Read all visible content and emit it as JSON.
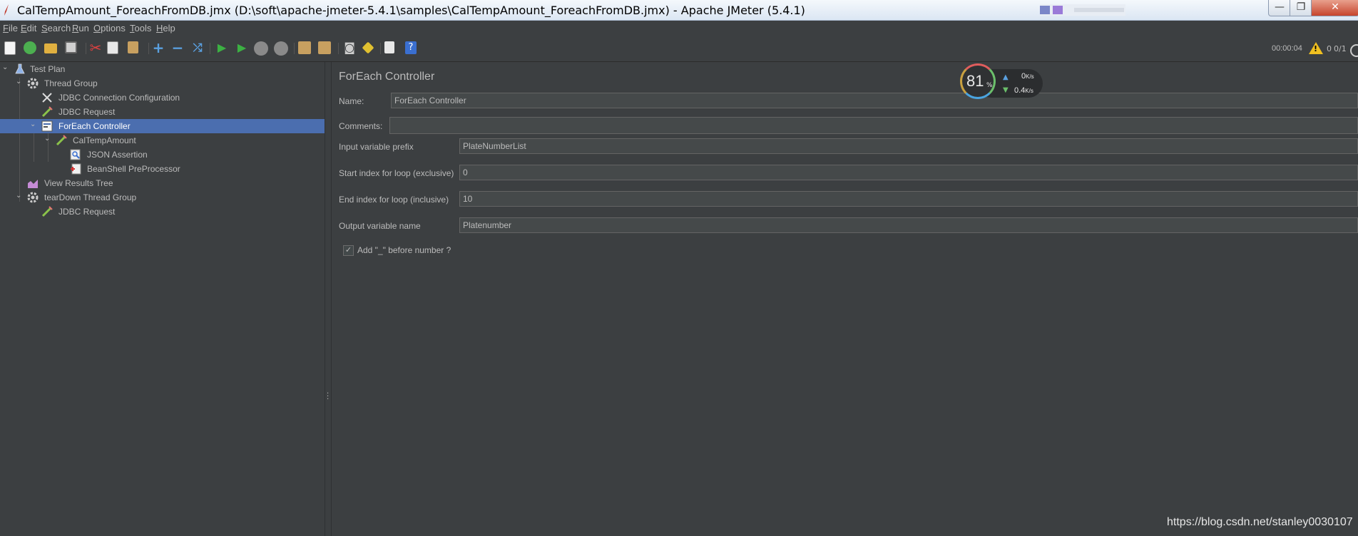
{
  "window": {
    "title": "CalTempAmount_ForeachFromDB.jmx (D:\\soft\\apache-jmeter-5.4.1\\samples\\CalTempAmount_ForeachFromDB.jmx) - Apache JMeter (5.4.1)",
    "min_glyph": "—",
    "max_glyph": "❐",
    "close_glyph": "✕"
  },
  "menu": [
    "File",
    "Edit",
    "Search",
    "Run",
    "Options",
    "Tools",
    "Help"
  ],
  "toolbar": {
    "icons": [
      "new-icon",
      "templates-icon",
      "open-icon",
      "save-icon",
      "cut-icon",
      "copy-icon",
      "paste-icon",
      "expand-icon",
      "collapse-icon",
      "toggle-icon",
      "start-icon",
      "start-no-pause-icon",
      "stop-icon",
      "shutdown-icon",
      "clear-icon",
      "clear-all-icon",
      "search-icon",
      "reset-search-icon",
      "function-helper-icon",
      "help-icon"
    ],
    "elapsed": "00:00:04",
    "error_count": "0",
    "threads": "0/1"
  },
  "tree": {
    "nodes": [
      {
        "label": "Test Plan",
        "icon": "flask-icon"
      },
      {
        "label": "Thread Group",
        "icon": "gear-icon"
      },
      {
        "label": "JDBC Connection Configuration",
        "icon": "wrench-icon"
      },
      {
        "label": "JDBC Request",
        "icon": "pipette-icon"
      },
      {
        "label": "ForEach Controller",
        "icon": "controller-icon",
        "selected": true
      },
      {
        "label": "CalTempAmount",
        "icon": "pipette-icon"
      },
      {
        "label": "JSON Assertion",
        "icon": "assertion-icon"
      },
      {
        "label": "BeanShell PreProcessor",
        "icon": "preprocessor-icon"
      },
      {
        "label": "View Results Tree",
        "icon": "chart-icon"
      },
      {
        "label": "tearDown Thread Group",
        "icon": "gear-icon"
      },
      {
        "label": "JDBC Request",
        "icon": "pipette-icon"
      }
    ]
  },
  "panel": {
    "title": "ForEach Controller",
    "name_label": "Name:",
    "name_value": "ForEach Controller",
    "comments_label": "Comments:",
    "comments_value": "",
    "input_prefix_label": "Input variable prefix",
    "input_prefix_value": "PlateNumberList",
    "start_index_label": "Start index for loop (exclusive)",
    "start_index_value": "0",
    "end_index_label": "End index for loop (inclusive)",
    "end_index_value": "10",
    "output_label": "Output variable name",
    "output_value": "Platenumber",
    "underscore_label": "Add \"_\" before number ?",
    "underscore_checked": true
  },
  "monitor": {
    "percent": "81",
    "percent_sign": "%",
    "upload": "0",
    "upload_unit": "K/s",
    "download": "0.4",
    "download_unit": "K/s"
  },
  "watermark": "https://blog.csdn.net/stanley0030107"
}
